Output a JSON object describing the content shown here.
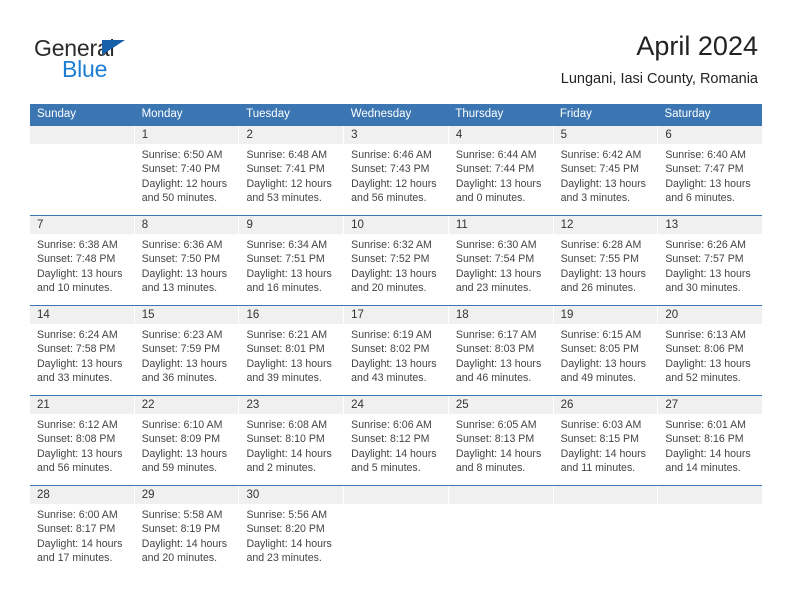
{
  "brand": {
    "word_one": "General",
    "word_two": "Blue",
    "triangle_color": "#1560a8",
    "blue_color": "#1a7fd4"
  },
  "header": {
    "title": "April 2024",
    "subtitle": "Lungani, Iasi County, Romania"
  },
  "theme": {
    "header_blue": "#3b76b3",
    "daynum_band": "#f0f0f0",
    "text": "#444444"
  },
  "weekday_headers": [
    "Sunday",
    "Monday",
    "Tuesday",
    "Wednesday",
    "Thursday",
    "Friday",
    "Saturday"
  ],
  "weeks": [
    [
      {
        "day": "",
        "sunrise": "",
        "sunset": "",
        "daylight_1": "",
        "daylight_2": ""
      },
      {
        "day": "1",
        "sunrise": "Sunrise: 6:50 AM",
        "sunset": "Sunset: 7:40 PM",
        "daylight_1": "Daylight: 12 hours",
        "daylight_2": "and 50 minutes."
      },
      {
        "day": "2",
        "sunrise": "Sunrise: 6:48 AM",
        "sunset": "Sunset: 7:41 PM",
        "daylight_1": "Daylight: 12 hours",
        "daylight_2": "and 53 minutes."
      },
      {
        "day": "3",
        "sunrise": "Sunrise: 6:46 AM",
        "sunset": "Sunset: 7:43 PM",
        "daylight_1": "Daylight: 12 hours",
        "daylight_2": "and 56 minutes."
      },
      {
        "day": "4",
        "sunrise": "Sunrise: 6:44 AM",
        "sunset": "Sunset: 7:44 PM",
        "daylight_1": "Daylight: 13 hours",
        "daylight_2": "and 0 minutes."
      },
      {
        "day": "5",
        "sunrise": "Sunrise: 6:42 AM",
        "sunset": "Sunset: 7:45 PM",
        "daylight_1": "Daylight: 13 hours",
        "daylight_2": "and 3 minutes."
      },
      {
        "day": "6",
        "sunrise": "Sunrise: 6:40 AM",
        "sunset": "Sunset: 7:47 PM",
        "daylight_1": "Daylight: 13 hours",
        "daylight_2": "and 6 minutes."
      }
    ],
    [
      {
        "day": "7",
        "sunrise": "Sunrise: 6:38 AM",
        "sunset": "Sunset: 7:48 PM",
        "daylight_1": "Daylight: 13 hours",
        "daylight_2": "and 10 minutes."
      },
      {
        "day": "8",
        "sunrise": "Sunrise: 6:36 AM",
        "sunset": "Sunset: 7:50 PM",
        "daylight_1": "Daylight: 13 hours",
        "daylight_2": "and 13 minutes."
      },
      {
        "day": "9",
        "sunrise": "Sunrise: 6:34 AM",
        "sunset": "Sunset: 7:51 PM",
        "daylight_1": "Daylight: 13 hours",
        "daylight_2": "and 16 minutes."
      },
      {
        "day": "10",
        "sunrise": "Sunrise: 6:32 AM",
        "sunset": "Sunset: 7:52 PM",
        "daylight_1": "Daylight: 13 hours",
        "daylight_2": "and 20 minutes."
      },
      {
        "day": "11",
        "sunrise": "Sunrise: 6:30 AM",
        "sunset": "Sunset: 7:54 PM",
        "daylight_1": "Daylight: 13 hours",
        "daylight_2": "and 23 minutes."
      },
      {
        "day": "12",
        "sunrise": "Sunrise: 6:28 AM",
        "sunset": "Sunset: 7:55 PM",
        "daylight_1": "Daylight: 13 hours",
        "daylight_2": "and 26 minutes."
      },
      {
        "day": "13",
        "sunrise": "Sunrise: 6:26 AM",
        "sunset": "Sunset: 7:57 PM",
        "daylight_1": "Daylight: 13 hours",
        "daylight_2": "and 30 minutes."
      }
    ],
    [
      {
        "day": "14",
        "sunrise": "Sunrise: 6:24 AM",
        "sunset": "Sunset: 7:58 PM",
        "daylight_1": "Daylight: 13 hours",
        "daylight_2": "and 33 minutes."
      },
      {
        "day": "15",
        "sunrise": "Sunrise: 6:23 AM",
        "sunset": "Sunset: 7:59 PM",
        "daylight_1": "Daylight: 13 hours",
        "daylight_2": "and 36 minutes."
      },
      {
        "day": "16",
        "sunrise": "Sunrise: 6:21 AM",
        "sunset": "Sunset: 8:01 PM",
        "daylight_1": "Daylight: 13 hours",
        "daylight_2": "and 39 minutes."
      },
      {
        "day": "17",
        "sunrise": "Sunrise: 6:19 AM",
        "sunset": "Sunset: 8:02 PM",
        "daylight_1": "Daylight: 13 hours",
        "daylight_2": "and 43 minutes."
      },
      {
        "day": "18",
        "sunrise": "Sunrise: 6:17 AM",
        "sunset": "Sunset: 8:03 PM",
        "daylight_1": "Daylight: 13 hours",
        "daylight_2": "and 46 minutes."
      },
      {
        "day": "19",
        "sunrise": "Sunrise: 6:15 AM",
        "sunset": "Sunset: 8:05 PM",
        "daylight_1": "Daylight: 13 hours",
        "daylight_2": "and 49 minutes."
      },
      {
        "day": "20",
        "sunrise": "Sunrise: 6:13 AM",
        "sunset": "Sunset: 8:06 PM",
        "daylight_1": "Daylight: 13 hours",
        "daylight_2": "and 52 minutes."
      }
    ],
    [
      {
        "day": "21",
        "sunrise": "Sunrise: 6:12 AM",
        "sunset": "Sunset: 8:08 PM",
        "daylight_1": "Daylight: 13 hours",
        "daylight_2": "and 56 minutes."
      },
      {
        "day": "22",
        "sunrise": "Sunrise: 6:10 AM",
        "sunset": "Sunset: 8:09 PM",
        "daylight_1": "Daylight: 13 hours",
        "daylight_2": "and 59 minutes."
      },
      {
        "day": "23",
        "sunrise": "Sunrise: 6:08 AM",
        "sunset": "Sunset: 8:10 PM",
        "daylight_1": "Daylight: 14 hours",
        "daylight_2": "and 2 minutes."
      },
      {
        "day": "24",
        "sunrise": "Sunrise: 6:06 AM",
        "sunset": "Sunset: 8:12 PM",
        "daylight_1": "Daylight: 14 hours",
        "daylight_2": "and 5 minutes."
      },
      {
        "day": "25",
        "sunrise": "Sunrise: 6:05 AM",
        "sunset": "Sunset: 8:13 PM",
        "daylight_1": "Daylight: 14 hours",
        "daylight_2": "and 8 minutes."
      },
      {
        "day": "26",
        "sunrise": "Sunrise: 6:03 AM",
        "sunset": "Sunset: 8:15 PM",
        "daylight_1": "Daylight: 14 hours",
        "daylight_2": "and 11 minutes."
      },
      {
        "day": "27",
        "sunrise": "Sunrise: 6:01 AM",
        "sunset": "Sunset: 8:16 PM",
        "daylight_1": "Daylight: 14 hours",
        "daylight_2": "and 14 minutes."
      }
    ],
    [
      {
        "day": "28",
        "sunrise": "Sunrise: 6:00 AM",
        "sunset": "Sunset: 8:17 PM",
        "daylight_1": "Daylight: 14 hours",
        "daylight_2": "and 17 minutes."
      },
      {
        "day": "29",
        "sunrise": "Sunrise: 5:58 AM",
        "sunset": "Sunset: 8:19 PM",
        "daylight_1": "Daylight: 14 hours",
        "daylight_2": "and 20 minutes."
      },
      {
        "day": "30",
        "sunrise": "Sunrise: 5:56 AM",
        "sunset": "Sunset: 8:20 PM",
        "daylight_1": "Daylight: 14 hours",
        "daylight_2": "and 23 minutes."
      },
      {
        "day": "",
        "sunrise": "",
        "sunset": "",
        "daylight_1": "",
        "daylight_2": ""
      },
      {
        "day": "",
        "sunrise": "",
        "sunset": "",
        "daylight_1": "",
        "daylight_2": ""
      },
      {
        "day": "",
        "sunrise": "",
        "sunset": "",
        "daylight_1": "",
        "daylight_2": ""
      },
      {
        "day": "",
        "sunrise": "",
        "sunset": "",
        "daylight_1": "",
        "daylight_2": ""
      }
    ]
  ]
}
